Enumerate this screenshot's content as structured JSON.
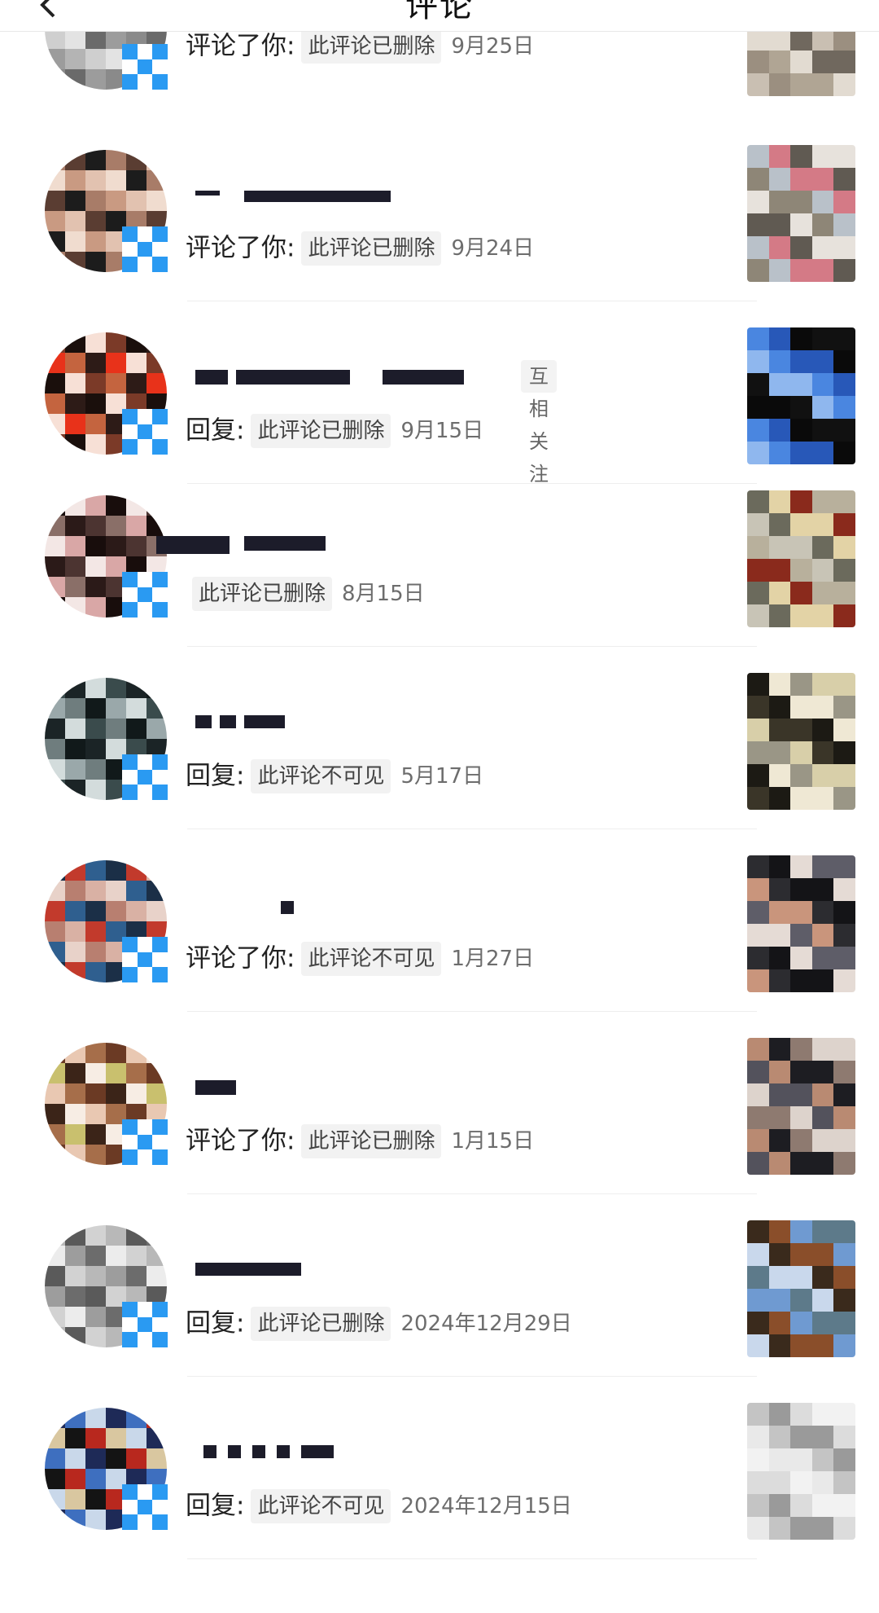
{
  "header": {
    "title": "评论",
    "back_icon": "chevron-left-icon"
  },
  "colors": {
    "badge": "#2a9af2",
    "quote_bg": "#f2f2f2",
    "date_text": "#6d6d6d"
  },
  "notifications": [
    {
      "action": "评论了你:",
      "quote": "此评论已删除",
      "date": "9月25日",
      "mutual_tag": ""
    },
    {
      "action": "评论了你:",
      "quote": "此评论已删除",
      "date": "9月24日",
      "mutual_tag": ""
    },
    {
      "action": "回复:",
      "quote": "此评论已删除",
      "date": "9月15日",
      "mutual_tag": "互相关注"
    },
    {
      "action": "",
      "quote": "此评论已删除",
      "date": "8月15日",
      "mutual_tag": ""
    },
    {
      "action": "回复:",
      "quote": "此评论不可见",
      "date": "5月17日",
      "mutual_tag": ""
    },
    {
      "action": "评论了你:",
      "quote": "此评论不可见",
      "date": "1月27日",
      "mutual_tag": ""
    },
    {
      "action": "评论了你:",
      "quote": "此评论已删除",
      "date": "1月15日",
      "mutual_tag": ""
    },
    {
      "action": "回复:",
      "quote": "此评论已删除",
      "date": "2024年12月29日",
      "mutual_tag": ""
    },
    {
      "action": "回复:",
      "quote": "此评论不可见",
      "date": "2024年12月15日",
      "mutual_tag": ""
    }
  ]
}
